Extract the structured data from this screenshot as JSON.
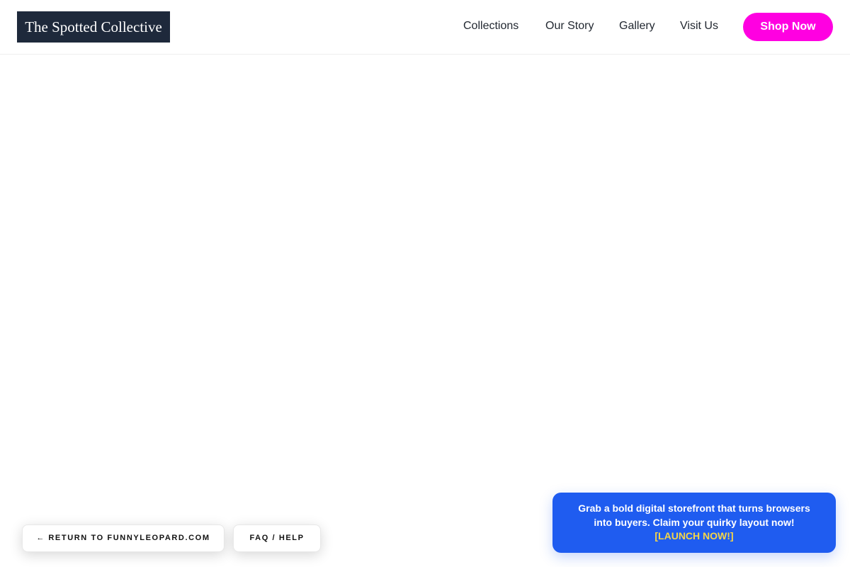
{
  "header": {
    "logo_text": "The Spotted Collective",
    "nav": {
      "collections": "Collections",
      "our_story": "Our Story",
      "gallery": "Gallery",
      "visit_us": "Visit Us"
    },
    "shop_button": "Shop Now"
  },
  "floating": {
    "return_arrow": "←",
    "return_label": "RETURN TO FUNNYLEOPARD.COM",
    "faq_label": "FAQ / HELP"
  },
  "promo": {
    "message": "Grab a bold digital storefront that turns browsers into buyers. Claim your quirky layout now!",
    "cta": "[LAUNCH NOW!]"
  },
  "colors": {
    "logo_bg": "#1e293b",
    "accent_pink": "#ff00e1",
    "promo_blue": "#1f5cf0",
    "promo_cta": "#f5d547"
  }
}
